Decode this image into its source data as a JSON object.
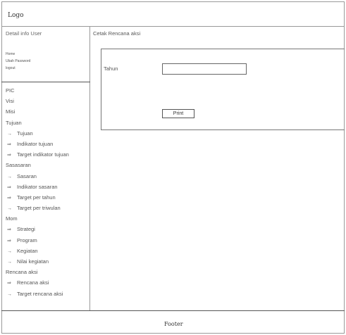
{
  "header": {
    "logo": "Logo"
  },
  "sidebar": {
    "user_title": "Detail info User",
    "quick_links": [
      "Home",
      "Ubah Password",
      "logout"
    ],
    "menu": [
      {
        "label": "PIC",
        "arrow": ""
      },
      {
        "label": "Visi",
        "arrow": ""
      },
      {
        "label": "Misi",
        "arrow": ""
      },
      {
        "label": "Tujuan",
        "arrow": ""
      },
      {
        "label": "Tujuan",
        "arrow": "→"
      },
      {
        "label": "Indikator tujuan",
        "arrow": "⇒"
      },
      {
        "label": "Target indikator tujuan",
        "arrow": "⇒"
      },
      {
        "label": "Sasasaran",
        "arrow": ""
      },
      {
        "label": "Sasaran",
        "arrow": "→"
      },
      {
        "label": "Indikator sasaran",
        "arrow": "⇒"
      },
      {
        "label": "Target per tahun",
        "arrow": "⇒"
      },
      {
        "label": "Target per triwulan",
        "arrow": "→"
      },
      {
        "label": "Mom",
        "arrow": ""
      },
      {
        "label": "Strategi",
        "arrow": "⇒"
      },
      {
        "label": "Program",
        "arrow": "⇒"
      },
      {
        "label": "Kegiatan",
        "arrow": "→"
      },
      {
        "label": "Nilai kegiatan",
        "arrow": "→"
      },
      {
        "label": "Rencana aksi",
        "arrow": ""
      },
      {
        "label": "Rencana aksi",
        "arrow": "⇒"
      },
      {
        "label": "Target rencana aksi",
        "arrow": "→"
      }
    ]
  },
  "main": {
    "title": "Cetak Rencana aksi",
    "form": {
      "year_label": "Tahun",
      "year_value": "",
      "print_label": "Print"
    }
  },
  "footer": {
    "text": "Footer"
  }
}
